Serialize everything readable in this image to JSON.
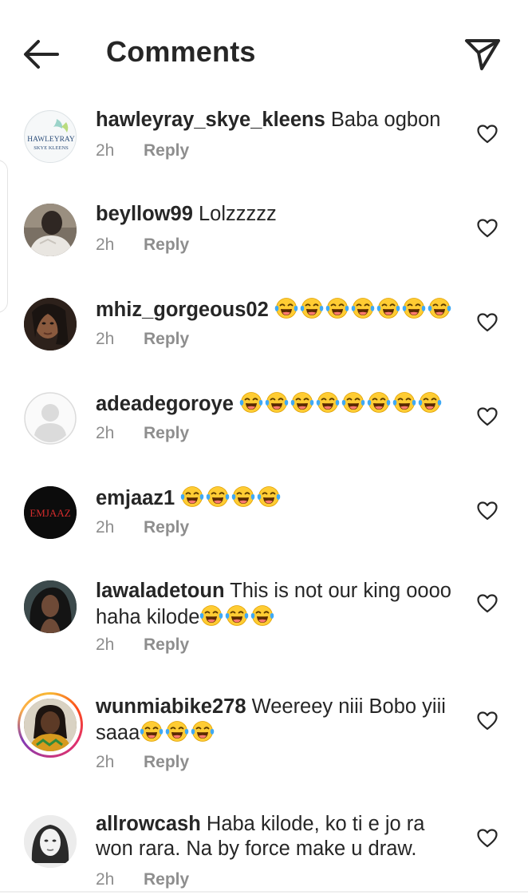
{
  "header": {
    "title": "Comments",
    "back_icon": "arrow-left-icon",
    "send_icon": "paper-plane-icon"
  },
  "comments": [
    {
      "username": "hawleyray_skye_kleens",
      "text": "Baba ogbon",
      "emoji_count": 0,
      "text_after_emoji": "",
      "time": "2h",
      "reply": "Reply",
      "avatar_text_1": "HAWLEYRAY",
      "avatar_text_2": "SKYE KLEENS"
    },
    {
      "username": "beyllow99",
      "text": "Lolzzzzz",
      "emoji_count": 0,
      "time": "2h",
      "reply": "Reply"
    },
    {
      "username": "mhiz_gorgeous02",
      "text": "",
      "emoji_count": 7,
      "time": "2h",
      "reply": "Reply"
    },
    {
      "username": "adeadegoroye",
      "text": "",
      "emoji_count": 8,
      "time": "2h",
      "reply": "Reply"
    },
    {
      "username": "emjaaz1",
      "text": "",
      "emoji_count": 4,
      "time": "2h",
      "reply": "Reply",
      "avatar_text": "EMJAAZ"
    },
    {
      "username": "lawaladetoun",
      "text": "This is not our king oooo haha kilode",
      "emoji_count": 3,
      "time": "2h",
      "reply": "Reply"
    },
    {
      "username": "wunmiabike278",
      "text": "Weereey niii Bobo yiii saaa",
      "emoji_count": 3,
      "time": "2h",
      "reply": "Reply"
    },
    {
      "username": "allrowcash",
      "text": "Haba kilode, ko ti e jo ra won rara. Na by force make u draw.",
      "emoji_count": 0,
      "time": "2h",
      "reply": "Reply"
    }
  ],
  "colors": {
    "text": "#262626",
    "muted": "#8e8e8e",
    "emoji_face": "#FFCC33",
    "emoji_tears": "#3fa9f5"
  },
  "icons": {
    "like": "heart-outline-icon",
    "emoji": "face-with-tears-of-joy-icon"
  }
}
